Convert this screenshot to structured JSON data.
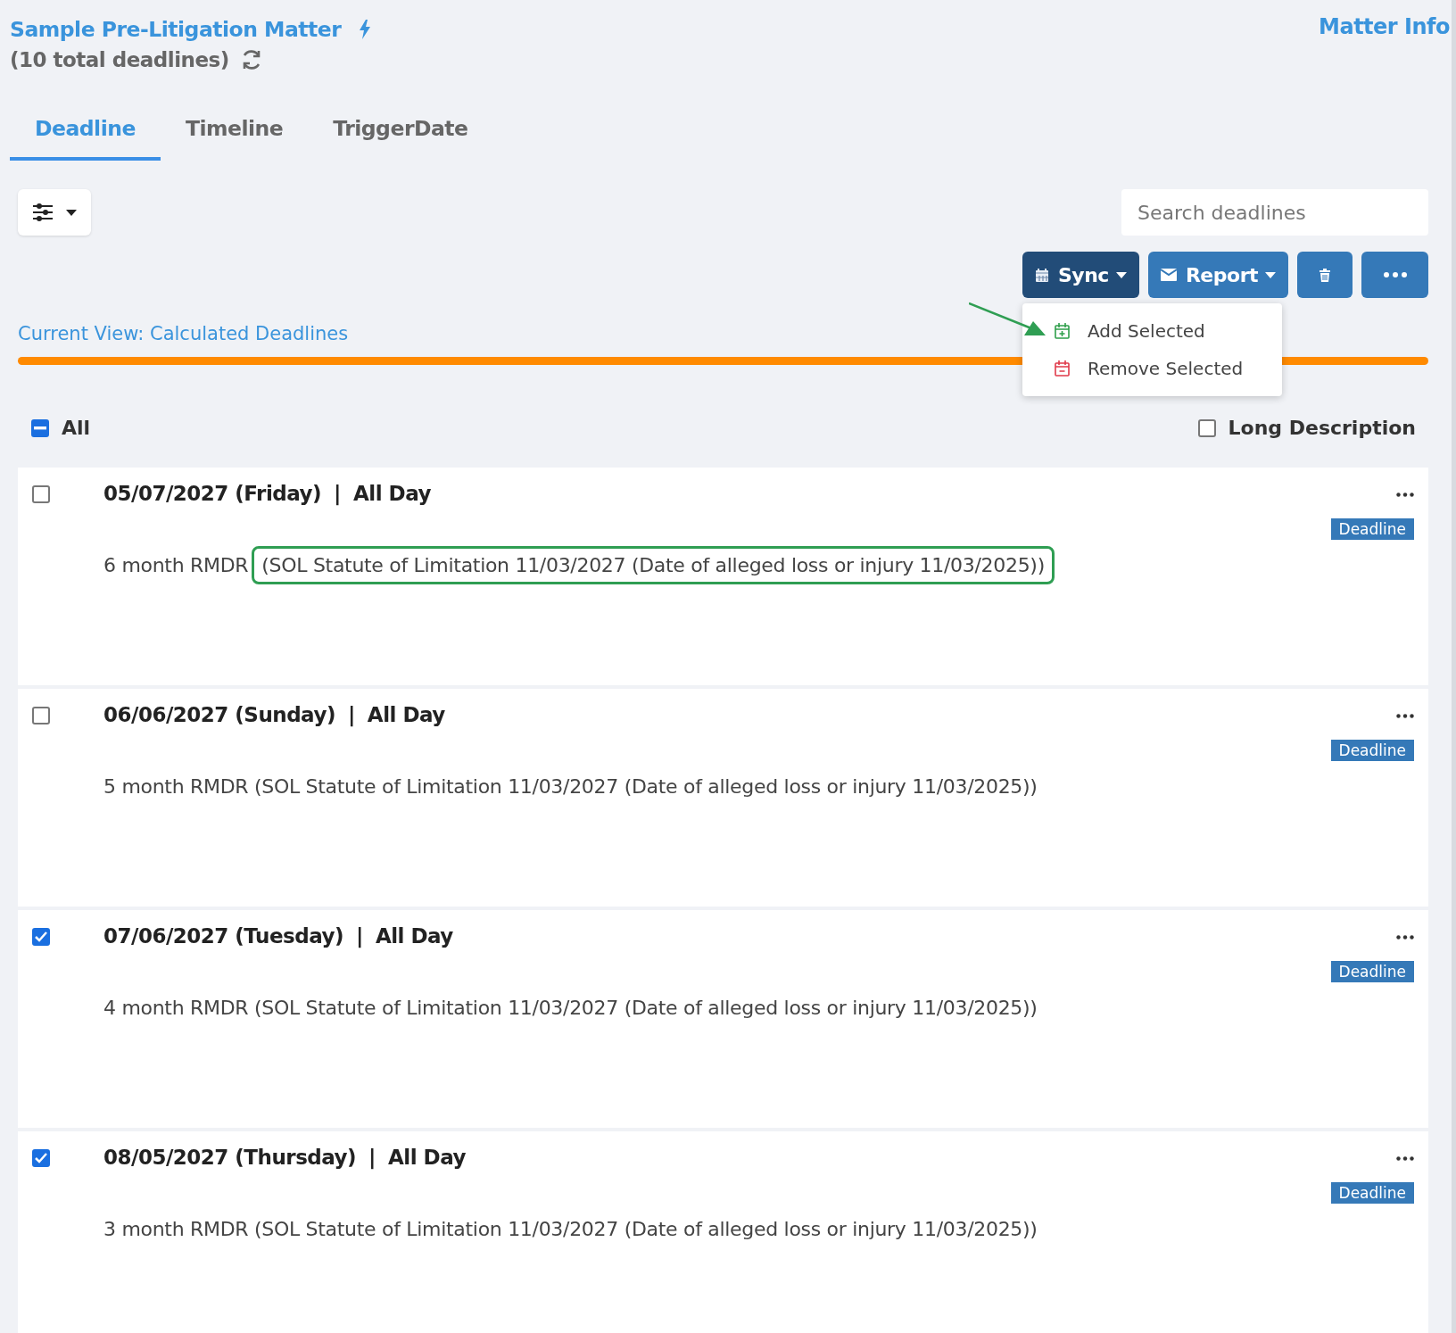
{
  "header": {
    "title": "Sample Pre-Litigation Matter",
    "subtitle": "(10 total deadlines)",
    "link": "Matter Info"
  },
  "tabs": [
    {
      "label": "Deadline",
      "selected": true
    },
    {
      "label": "Timeline",
      "selected": false
    },
    {
      "label": "TriggerDate",
      "selected": false
    }
  ],
  "search": {
    "placeholder": "Search deadlines"
  },
  "toolbar": [
    {
      "kind": "sync",
      "label": "Sync",
      "open": true
    },
    {
      "kind": "report",
      "label": "Report",
      "open": false
    },
    {
      "kind": "delete",
      "open": false
    },
    {
      "kind": "more",
      "open": false
    }
  ],
  "sync_menu": [
    {
      "kind": "add",
      "label": "Add Selected",
      "pointed": true
    },
    {
      "kind": "remove",
      "label": "Remove Selected",
      "pointed": false
    }
  ],
  "current_view": "Current View: Calculated Deadlines",
  "select_all": {
    "label": "All",
    "indeterminate": true
  },
  "long_description": {
    "label": "Long Description",
    "checked": false
  },
  "deadlines": [
    {
      "checked": false,
      "date": "05/07/2027 (Friday)",
      "separator": "|",
      "time": "All Day",
      "tag": "Deadline",
      "description": [
        {
          "text": "6 month RMDR",
          "highlight": false
        },
        {
          "text": "(SOL Statute of Limitation 11/03/2027 (Date of alleged loss or injury 11/03/2025))",
          "highlight": true
        }
      ]
    },
    {
      "checked": false,
      "date": "06/06/2027 (Sunday)",
      "separator": "|",
      "time": "All Day",
      "tag": "Deadline",
      "description": [
        {
          "text": "5 month RMDR (SOL Statute of Limitation 11/03/2027 (Date of alleged loss or injury 11/03/2025))",
          "highlight": false
        }
      ]
    },
    {
      "checked": true,
      "date": "07/06/2027 (Tuesday)",
      "separator": "|",
      "time": "All Day",
      "tag": "Deadline",
      "description": [
        {
          "text": "4 month RMDR (SOL Statute of Limitation 11/03/2027 (Date of alleged loss or injury 11/03/2025))",
          "highlight": false
        }
      ]
    },
    {
      "checked": true,
      "date": "08/05/2027 (Thursday)",
      "separator": "|",
      "time": "All Day",
      "tag": "Deadline",
      "description": [
        {
          "text": "3 month RMDR (SOL Statute of Limitation 11/03/2027 (Date of alleged loss or injury 11/03/2025))",
          "highlight": false
        }
      ]
    }
  ]
}
